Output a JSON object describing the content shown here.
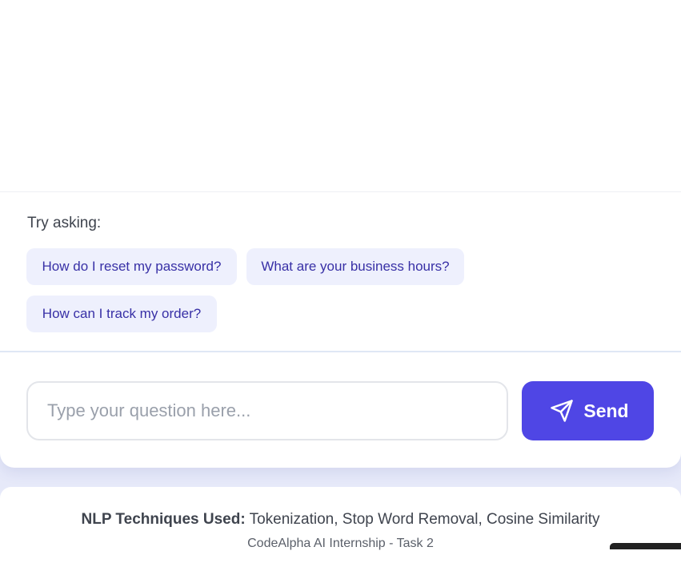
{
  "suggestions": {
    "label": "Try asking:",
    "chips": [
      "How do I reset my password?",
      "What are your business hours?",
      "How can I track my order?"
    ]
  },
  "composer": {
    "placeholder": "Type your question here...",
    "value": "",
    "send_label": "Send",
    "send_icon": "paper-plane-icon"
  },
  "footer": {
    "nlp_label": "NLP Techniques Used:",
    "nlp_value": " Tokenization, Stop Word Removal, Cosine Similarity",
    "credit": "CodeAlpha AI Internship - Task 2"
  },
  "colors": {
    "accent": "#4f46e5",
    "chip_bg": "#eef0fd",
    "chip_text": "#3830a6",
    "page_bg": "#e6e9f9"
  }
}
